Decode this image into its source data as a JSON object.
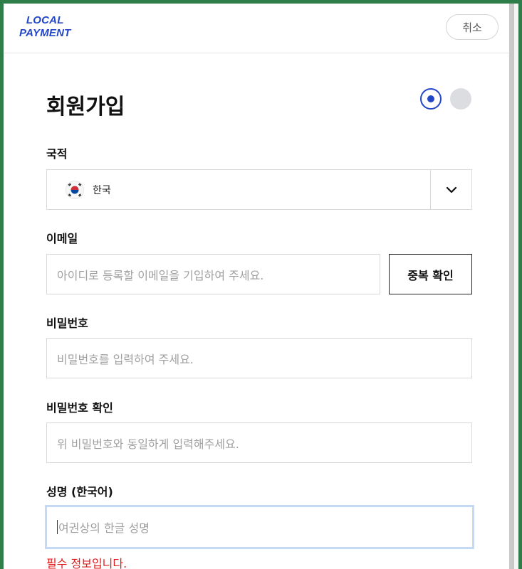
{
  "header": {
    "logo_line1": "LOCAL",
    "logo_line2": "PAYMENT",
    "cancel_label": "취소"
  },
  "page": {
    "title": "회원가입",
    "steps": [
      "step-1-active",
      "step-2-inactive"
    ]
  },
  "nationality": {
    "label": "국적",
    "selected": "한국"
  },
  "email": {
    "label": "이메일",
    "placeholder": "아이디로 등록할 이메일을 기입하여 주세요.",
    "check_button": "중복 확인"
  },
  "password": {
    "label": "비밀번호",
    "placeholder": "비밀번호를 입력하여 주세요."
  },
  "password_confirm": {
    "label": "비밀번호 확인",
    "placeholder": "위 비밀번호와 동일하게 입력해주세요."
  },
  "name": {
    "label": "성명 (한국어)",
    "placeholder": "여권상의 한글 성명",
    "error": "필수 정보입니다."
  },
  "colors": {
    "brand": "#2146c7",
    "error": "#e01a1a",
    "focus_border": "#c3d9f7"
  },
  "icons": {
    "flag": "south-korea-flag-icon",
    "dropdown": "chevron-down-icon"
  }
}
